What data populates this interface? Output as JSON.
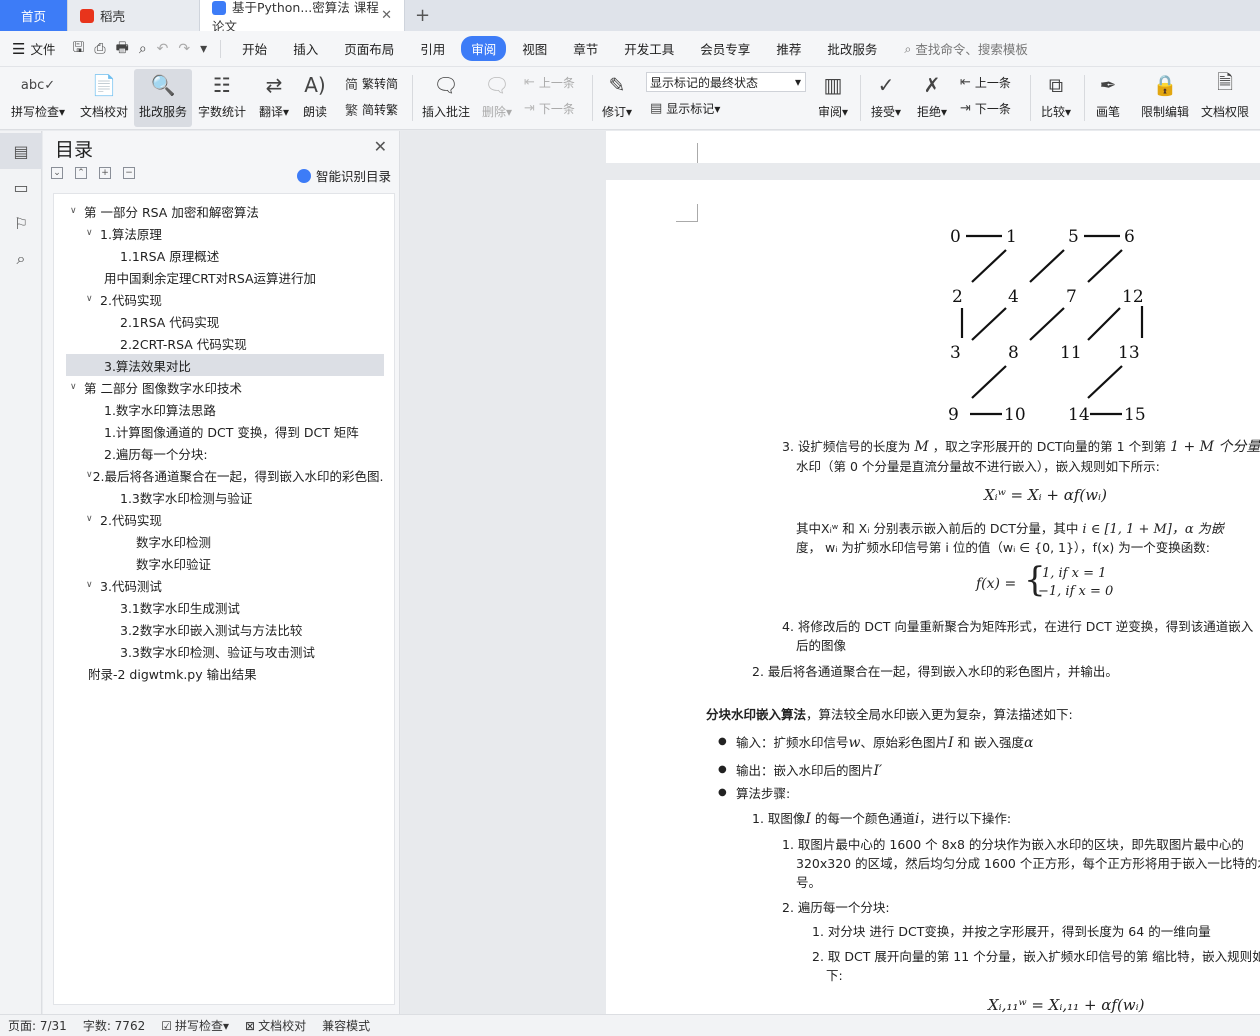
{
  "tabs": [
    {
      "label": "首页"
    },
    {
      "label": "稻壳"
    },
    {
      "label": "基于Python...密算法 课程论文"
    }
  ],
  "menu": {
    "file": "文件",
    "items": [
      "开始",
      "插入",
      "页面布局",
      "引用",
      "审阅",
      "视图",
      "章节",
      "开发工具",
      "会员专享",
      "推荐",
      "批改服务"
    ],
    "active": "审阅",
    "search": "查找命令、搜索模板"
  },
  "ribbon": {
    "spell": "拼写检查",
    "doc_check": "文档校对",
    "review_service": "批改服务",
    "word_count": "字数统计",
    "translate": "翻译",
    "read_aloud": "朗读",
    "trad_to_simp": "繁转简",
    "simp_to_trad": "简转繁",
    "insert_comment": "插入批注",
    "delete": "删除",
    "prev": "上一条",
    "next": "下一条",
    "revise": "修订",
    "markup_dropdown": "显示标记的最终状态",
    "show_markup": "显示标记",
    "review": "审阅",
    "accept": "接受",
    "reject": "拒绝",
    "prev2": "上一条",
    "next2": "下一条",
    "compare": "比较",
    "pen": "画笔",
    "restrict_edit": "限制编辑",
    "doc_permission": "文档权限"
  },
  "toc": {
    "title": "目录",
    "ai": "智能识别目录",
    "items": [
      {
        "label": "第 一部分 RSA 加密和解密算法",
        "arrow": "v"
      },
      {
        "label": "1.算法原理",
        "arrow": "v"
      },
      {
        "label": "1.1RSA 原理概述",
        "arrow": ""
      },
      {
        "label": "用中国剩余定理CRT对RSA运算进行加",
        "arrow": ""
      },
      {
        "label": "2.代码实现",
        "arrow": "v"
      },
      {
        "label": "2.1RSA 代码实现",
        "arrow": ""
      },
      {
        "label": "2.2CRT-RSA 代码实现",
        "arrow": ""
      },
      {
        "label": "3.算法效果对比",
        "arrow": ""
      },
      {
        "label": "第 二部分 图像数字水印技术",
        "arrow": "v"
      },
      {
        "label": "1.数字水印算法思路",
        "arrow": ""
      },
      {
        "label": "1.计算图像通道的 DCT 变换，得到 DCT 矩阵",
        "arrow": ""
      },
      {
        "label": "2.遍历每一个分块:",
        "arrow": ""
      },
      {
        "label": "2.最后将各通道聚合在一起，得到嵌入水印的彩色图...",
        "arrow": "v"
      },
      {
        "label": "1.3数字水印检测与验证",
        "arrow": ""
      },
      {
        "label": "2.代码实现",
        "arrow": "v"
      },
      {
        "label": "数字水印检测",
        "arrow": ""
      },
      {
        "label": "数字水印验证",
        "arrow": ""
      },
      {
        "label": "3.代码测试",
        "arrow": "v"
      },
      {
        "label": "3.1数字水印生成测试",
        "arrow": ""
      },
      {
        "label": "3.2数字水印嵌入测试与方法比较",
        "arrow": ""
      },
      {
        "label": "3.3数字水印检测、验证与攻击测试",
        "arrow": ""
      },
      {
        "label": "附录-2 digwtmk.py 输出结果",
        "arrow": ""
      }
    ]
  },
  "doc": {
    "zigzag": [
      "0",
      "1",
      "5",
      "6",
      "2",
      "4",
      "7",
      "12",
      "3",
      "8",
      "11",
      "13",
      "9",
      "10",
      "14",
      "15"
    ],
    "p3_a": "3. 设扩频信号的长度为",
    "p3_m": "M",
    "p3_b": "，取之字形展开的 DCT向量的第",
    "p3_c": "1 个到第",
    "p3_d": "1 + M 个分量",
    "p3_e": "水印（第 0 个分量是直流分量故不进行嵌入），嵌入规则如下所示:",
    "eq1": "Xᵢʷ = Xᵢ + αf(wᵢ)",
    "p_where_a": "其中Xᵢʷ 和 Xᵢ 分别表示嵌入前后的 DCT分量，其中",
    "p_where_b": "i ∈ [1, 1 + M]，α 为嵌",
    "p_where_c": "度，",
    "p_where_d": "wᵢ 为扩频水印信号第",
    "p_where_e": "i 位的值（wᵢ ∈ {0, 1}），f(x) 为一个变换函数:",
    "eq2_lhs": "f(x) =",
    "eq2_case1": "1,   if x = 1",
    "eq2_case2": "−1,  if x = 0",
    "p4": "4. 将修改后的 DCT 向量重新聚合为矩阵形式，在进行 DCT 逆变换，得到该通道嵌入",
    "p4b": "后的图像",
    "p2": "2. 最后将各通道聚合在一起，得到嵌入水印的彩色图片，并输出。",
    "block_title": "分块水印嵌入算法",
    "block_rest": "，算法较全局水印嵌入更为复杂，算法描述如下:",
    "b1": "输入：扩频水印信号",
    "b1_w": "w",
    "b1_b": "、原始彩色图片",
    "b1_i": "I",
    "b1_c": " 和 嵌入强度",
    "b1_a": "α",
    "b2": "输出：嵌入水印后的图片",
    "b2_i": "I′",
    "b3": "算法步骤:",
    "s1": "1. 取图像",
    "s1_i": "I",
    "s1_b": " 的每一个颜色通道",
    "s1_c": "i",
    "s1_d": "，进行以下操作:",
    "s11": "1. 取图片最中心的 1600 个 8x8 的分块作为嵌入水印的区块，即先取图片最中心的",
    "s11b": "320x320 的区域，然后均匀分成 1600 个正方形，每个正方形将用于嵌入一比特的水印",
    "s11c": "号。",
    "s12": "2. 遍历每一个分块:",
    "s121": "1. 对分块 进行 DCT变换，并按之字形展开，得到长度为 64 的一维向量",
    "s122": "2. 取 DCT 展开向量的第 11 个分量，嵌入扩频水印信号的第 缩比特，嵌入规则如",
    "s122b": "下:",
    "eq3": "Xᵢ,₁₁ʷ = Xᵢ,₁₁ + αf(wᵢ)"
  },
  "status": {
    "page": "页面: 7/31",
    "words": "字数: 7762",
    "spell": "拼写检查",
    "doc_check": "文档校对",
    "compat": "兼容模式"
  }
}
